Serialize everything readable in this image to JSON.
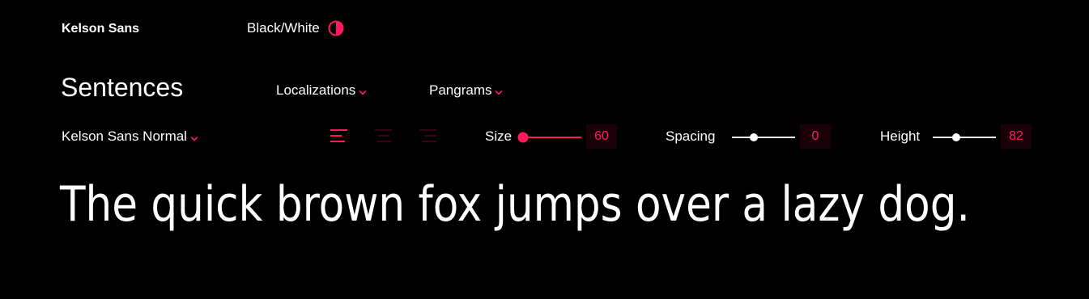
{
  "header": {
    "brand": "Kelson Sans",
    "theme_toggle_label": "Black/White"
  },
  "section": {
    "title": "Sentences",
    "localizations_label": "Localizations",
    "pangrams_label": "Pangrams"
  },
  "controls": {
    "font_style": "Kelson Sans Normal",
    "alignment": {
      "options": [
        "align-left",
        "align-center",
        "align-right"
      ],
      "selected": "align-left"
    },
    "size": {
      "label": "Size",
      "value": "60"
    },
    "spacing": {
      "label": "Spacing",
      "value": "0"
    },
    "height": {
      "label": "Height",
      "value": "82"
    }
  },
  "sample": {
    "text": "The quick brown fox jumps over a lazy dog."
  },
  "colors": {
    "background": "#000000",
    "text": "#ffffff",
    "accent": "#ff1a5e",
    "accent_dim": "#3a0418",
    "value_bg": "#1a0009"
  },
  "icons": {
    "theme": "half-circle-icon",
    "chevron": "chevron-down-icon"
  }
}
